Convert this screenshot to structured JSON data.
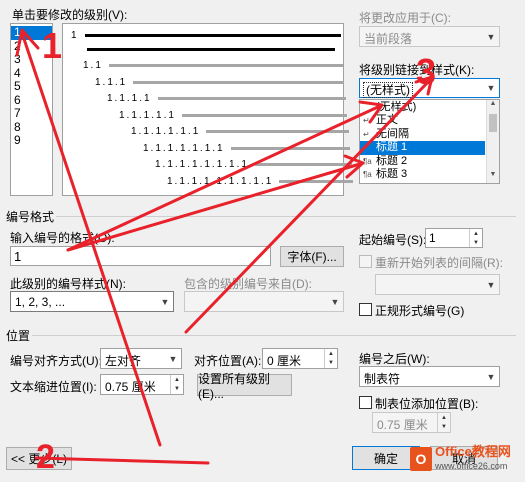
{
  "level_select": {
    "label": "单击要修改的级别(V):",
    "items": [
      "1",
      "2",
      "3",
      "4",
      "5",
      "6",
      "7",
      "8",
      "9"
    ],
    "selected": "1"
  },
  "preview": {
    "rows": [
      "1",
      "1.1",
      "1.1.1",
      "1.1.1.1",
      "1.1.1.1.1",
      "1.1.1.1.1.1",
      "1.1.1.1.1.1.1",
      "1.1.1.1.1.1.1.1",
      "1.1.1.1.1.1.1.1.1"
    ]
  },
  "apply_to": {
    "label": "将更改应用于(C):",
    "value": "当前段落"
  },
  "link_style": {
    "label": "将级别链接到样式(K):",
    "value": "(无样式)",
    "items": [
      {
        "icon": "",
        "text": "(无样式)"
      },
      {
        "icon": "↵",
        "text": "正文"
      },
      {
        "icon": "↵",
        "text": "无间隔"
      },
      {
        "icon": "",
        "text": "标题 1"
      },
      {
        "icon": "¶a",
        "text": "标题 2"
      },
      {
        "icon": "¶a",
        "text": "标题 3"
      }
    ],
    "selected_index": 3
  },
  "number_format": {
    "group_label": "编号格式",
    "input_label": "输入编号的格式(O):",
    "input_value": "1",
    "font_button": "字体(F)...",
    "style_label": "此级别的编号样式(N):",
    "style_value": "1, 2, 3, ...",
    "include_label": "包含的级别编号来自(D):",
    "start_label": "起始编号(S):",
    "start_value": "1",
    "restart_label": "重新开始列表的间隔(R):",
    "legal_label": "正规形式编号(G)"
  },
  "position": {
    "group_label": "位置",
    "align_label": "编号对齐方式(U):",
    "align_value": "左对齐",
    "align_at_label": "对齐位置(A):",
    "align_at_value": "0 厘米",
    "indent_label": "文本缩进位置(I):",
    "indent_value": "0.75 厘米",
    "set_all_button": "设置所有级别(E)...",
    "follow_label": "编号之后(W):",
    "follow_value": "制表符",
    "tab_stop_label": "制表位添加位置(B):",
    "tab_stop_value": "0.75 厘米"
  },
  "footer": {
    "less_button": "<< 更少(L)",
    "ok_button": "确定",
    "cancel_button": "取消"
  },
  "annotations": [
    "1",
    "2",
    "3"
  ],
  "watermark": {
    "name": "Office教程网",
    "url": "www.office26.com"
  },
  "colors": {
    "selection": "#0078d7",
    "annotation": "#e8212a",
    "dialog_bg": "#f0f0f0"
  }
}
